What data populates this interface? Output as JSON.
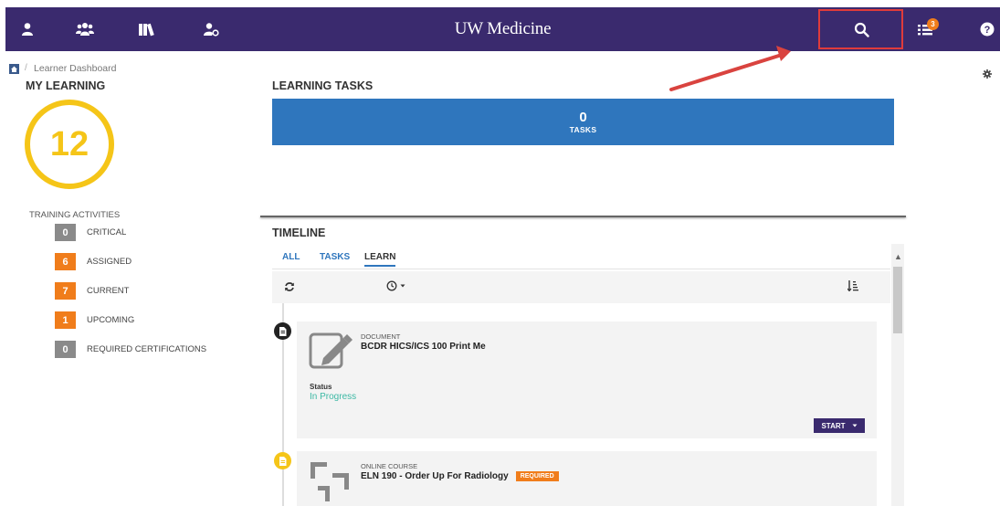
{
  "header": {
    "title": "UW Medicine",
    "notification_count": "3",
    "icons": [
      "user-icon",
      "users-icon",
      "library-icon",
      "user-settings-icon",
      "search-icon",
      "task-list-icon",
      "help-icon"
    ]
  },
  "breadcrumb": {
    "current": "Learner Dashboard"
  },
  "my_learning": {
    "heading": "MY LEARNING",
    "total": "12",
    "activities_title": "TRAINING ACTIVITIES",
    "activities": [
      {
        "count": "0",
        "label": "CRITICAL",
        "color": "#8a8a8a"
      },
      {
        "count": "6",
        "label": "ASSIGNED",
        "color": "#f07d1b"
      },
      {
        "count": "7",
        "label": "CURRENT",
        "color": "#f07d1b"
      },
      {
        "count": "1",
        "label": "UPCOMING",
        "color": "#f07d1b"
      },
      {
        "count": "0",
        "label": "REQUIRED CERTIFICATIONS",
        "color": "#8a8a8a"
      }
    ]
  },
  "learning_tasks": {
    "heading": "LEARNING TASKS",
    "count": "0",
    "label": "TASKS"
  },
  "timeline": {
    "heading": "TIMELINE",
    "tabs": [
      "ALL",
      "TASKS",
      "LEARN"
    ],
    "active_tab": "LEARN",
    "items": [
      {
        "type": "DOCUMENT",
        "title": "BCDR HICS/ICS 100 Print Me",
        "status_label": "Status",
        "status_value": "In Progress",
        "action": "START"
      },
      {
        "type": "ONLINE COURSE",
        "title": "ELN 190 - Order Up For Radiology",
        "badge": "REQUIRED"
      }
    ]
  },
  "colors": {
    "header_bg": "#3a2a6e",
    "accent_blue": "#2f76bd",
    "ring": "#f5c518",
    "orange": "#f07d1b",
    "status_green": "#3cb8a4",
    "highlight_red": "#e03b3b"
  }
}
